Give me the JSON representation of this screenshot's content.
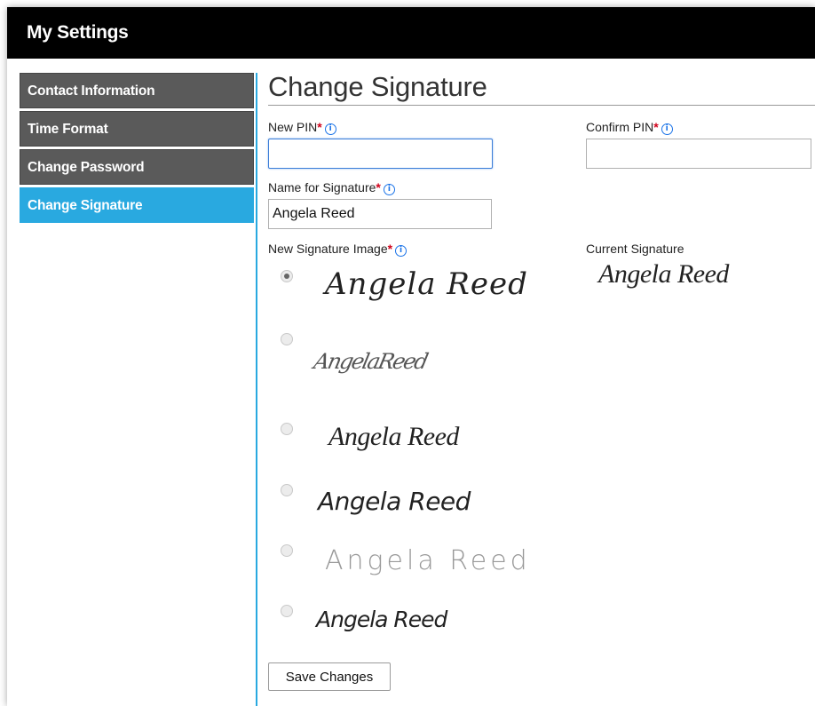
{
  "window": {
    "title": "My Settings"
  },
  "sidebar": {
    "items": [
      {
        "label": "Contact Information",
        "active": false
      },
      {
        "label": "Time Format",
        "active": false
      },
      {
        "label": "Change Password",
        "active": false
      },
      {
        "label": "Change Signature",
        "active": true
      }
    ]
  },
  "main": {
    "title": "Change Signature",
    "new_pin": {
      "label": "New PIN",
      "value": ""
    },
    "confirm_pin": {
      "label": "Confirm PIN",
      "value": ""
    },
    "signature_name": {
      "label": "Name for Signature",
      "value": "Angela Reed"
    },
    "new_signature_image": {
      "label": "New Signature Image",
      "options": [
        {
          "text": "Angela Reed",
          "selected": true
        },
        {
          "text": "AngelaReed",
          "selected": false
        },
        {
          "text": "Angela Reed",
          "selected": false
        },
        {
          "text": "Angela Reed",
          "selected": false
        },
        {
          "text": "Angela Reed",
          "selected": false
        },
        {
          "text": "Angela Reed",
          "selected": false
        }
      ]
    },
    "current_signature": {
      "label": "Current Signature",
      "text": "Angela Reed"
    },
    "save_label": "Save Changes"
  },
  "icons": {
    "info": "info-circle-icon",
    "radio": "radio-icon"
  },
  "colors": {
    "accent": "#29a9e0",
    "sidebar_item": "#5a5a5a",
    "required": "#d0021b",
    "info": "#1a73e8"
  }
}
